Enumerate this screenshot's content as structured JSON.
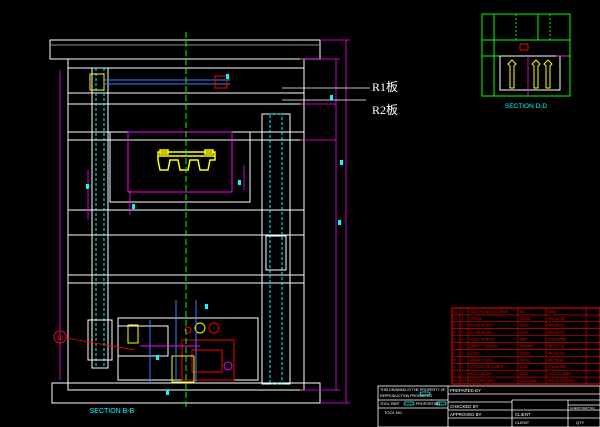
{
  "plate_labels": {
    "r1": "R1板",
    "r2": "R2板"
  },
  "section_labels": {
    "main": "SECTION B-B",
    "detail": "SECTION D-D"
  },
  "balloon": {
    "id": "10"
  },
  "title_block": {
    "notes_line1": "THIS DRAWING IS THE PROPERTY OF",
    "notes_line2": "REPRODUCTION PROHIBITED",
    "tool_part_label": "TOOL PART",
    "proportion_label": "PROPORTION",
    "tool_no_label": "TOOL NO.",
    "prepared_by": "PREPARED BY",
    "checked_by": "CHECKED BY",
    "approved_by": "APPROVED BY",
    "client_label": "CLIENT",
    "client_label2": "CLIENT",
    "client_sub": "APPROVED",
    "part_no": "CLIENT PART NO.",
    "qty": "QTY"
  },
  "bom": {
    "rows": [
      {
        "no": "12",
        "qty": "1",
        "name": "LOCATE RING SCREW",
        "size": "M6",
        "mat": "S45C"
      },
      {
        "no": "11",
        "qty": "1",
        "name": "SPRUE",
        "size": "SKD61",
        "mat": "HRC48-52"
      },
      {
        "no": "10",
        "qty": "2",
        "name": "GUIDE PLATE",
        "size": "SKD11",
        "mat": "HRC58-60"
      },
      {
        "no": "9",
        "qty": "4",
        "name": "GUIDE BUSH",
        "size": "SUJ2",
        "mat": "HRC58-60"
      },
      {
        "no": "8",
        "qty": "4",
        "name": "SLIDE SPRING",
        "size": "SWP",
        "mat": "STANDARD"
      },
      {
        "no": "7",
        "qty": "2",
        "name": "SAFETY SCREW",
        "size": "SCM440",
        "mat": "HRC32-35"
      },
      {
        "no": "6",
        "qty": "2",
        "name": "SLIDE",
        "size": "SKD61",
        "mat": "HRC48-52"
      },
      {
        "no": "5",
        "qty": "2",
        "name": "WEAR PLATE",
        "size": "SKD11",
        "mat": "HRC58-60"
      },
      {
        "no": "4",
        "qty": "4",
        "name": "STROKE RETAINER",
        "size": "S45C",
        "mat": "STANDARD"
      },
      {
        "no": "3",
        "qty": "1",
        "name": "MOLD BASE",
        "size": "S50C",
        "mat": "LKM-SG 4550"
      }
    ],
    "header": {
      "no": "NO.",
      "qty": "QTY",
      "name": "DESCRIPTION",
      "size": "MATERIAL",
      "mat": "SPECIFICATION"
    }
  },
  "colors": {
    "background": "#000000",
    "outline": "#ffffff",
    "dimension": "#ff00ff",
    "center_line": "#00ff00",
    "hidden": "#00ffff",
    "parts": "#ffff00",
    "red": "#ff0000",
    "blue": "#3b7bff"
  }
}
